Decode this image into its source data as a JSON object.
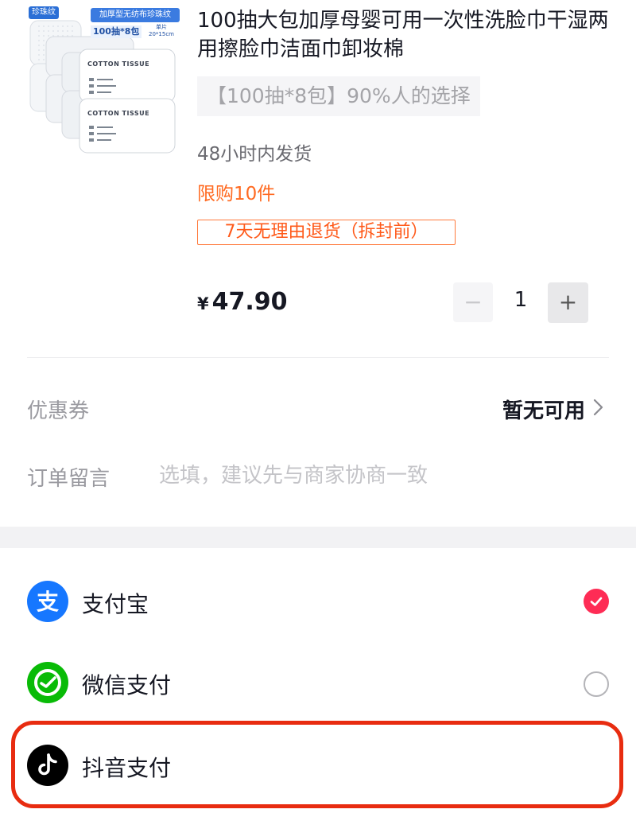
{
  "product": {
    "title": "100抽大包加厚母婴可用一次性洗脸巾干湿两用擦脸巾洁面巾卸妆棉",
    "spec": "【100抽*8包】90%人的选择",
    "shipping": "48小时内发货",
    "limit": "限购10件",
    "return_policy": "7天无理由退货（拆封前）",
    "image": {
      "badge": "珍珠纹",
      "banner": "加厚型无纺布珍珠纹",
      "count_label": "100抽*8包",
      "size_label": "单片 20*15cm",
      "pack_label": "COTTON TISSUE"
    }
  },
  "price": {
    "currency": "¥",
    "amount": "47.90"
  },
  "quantity": {
    "minus": "−",
    "value": "1",
    "plus": "+"
  },
  "coupon": {
    "label": "优惠券",
    "value": "暂无可用"
  },
  "memo": {
    "label": "订单留言",
    "placeholder": "选填，建议先与商家协商一致"
  },
  "payment_methods": [
    {
      "name": "支付宝",
      "icon": "alipay-icon",
      "color": "#1677ff",
      "selected": true
    },
    {
      "name": "微信支付",
      "icon": "wechat-pay-icon",
      "color": "#09bb07",
      "selected": false
    },
    {
      "name": "抖音支付",
      "icon": "douyin-icon",
      "color": "#000000",
      "selected": false
    }
  ],
  "colors": {
    "accent": "#fe2c55",
    "limit": "#ff6a21",
    "highlight": "#e82c10"
  }
}
